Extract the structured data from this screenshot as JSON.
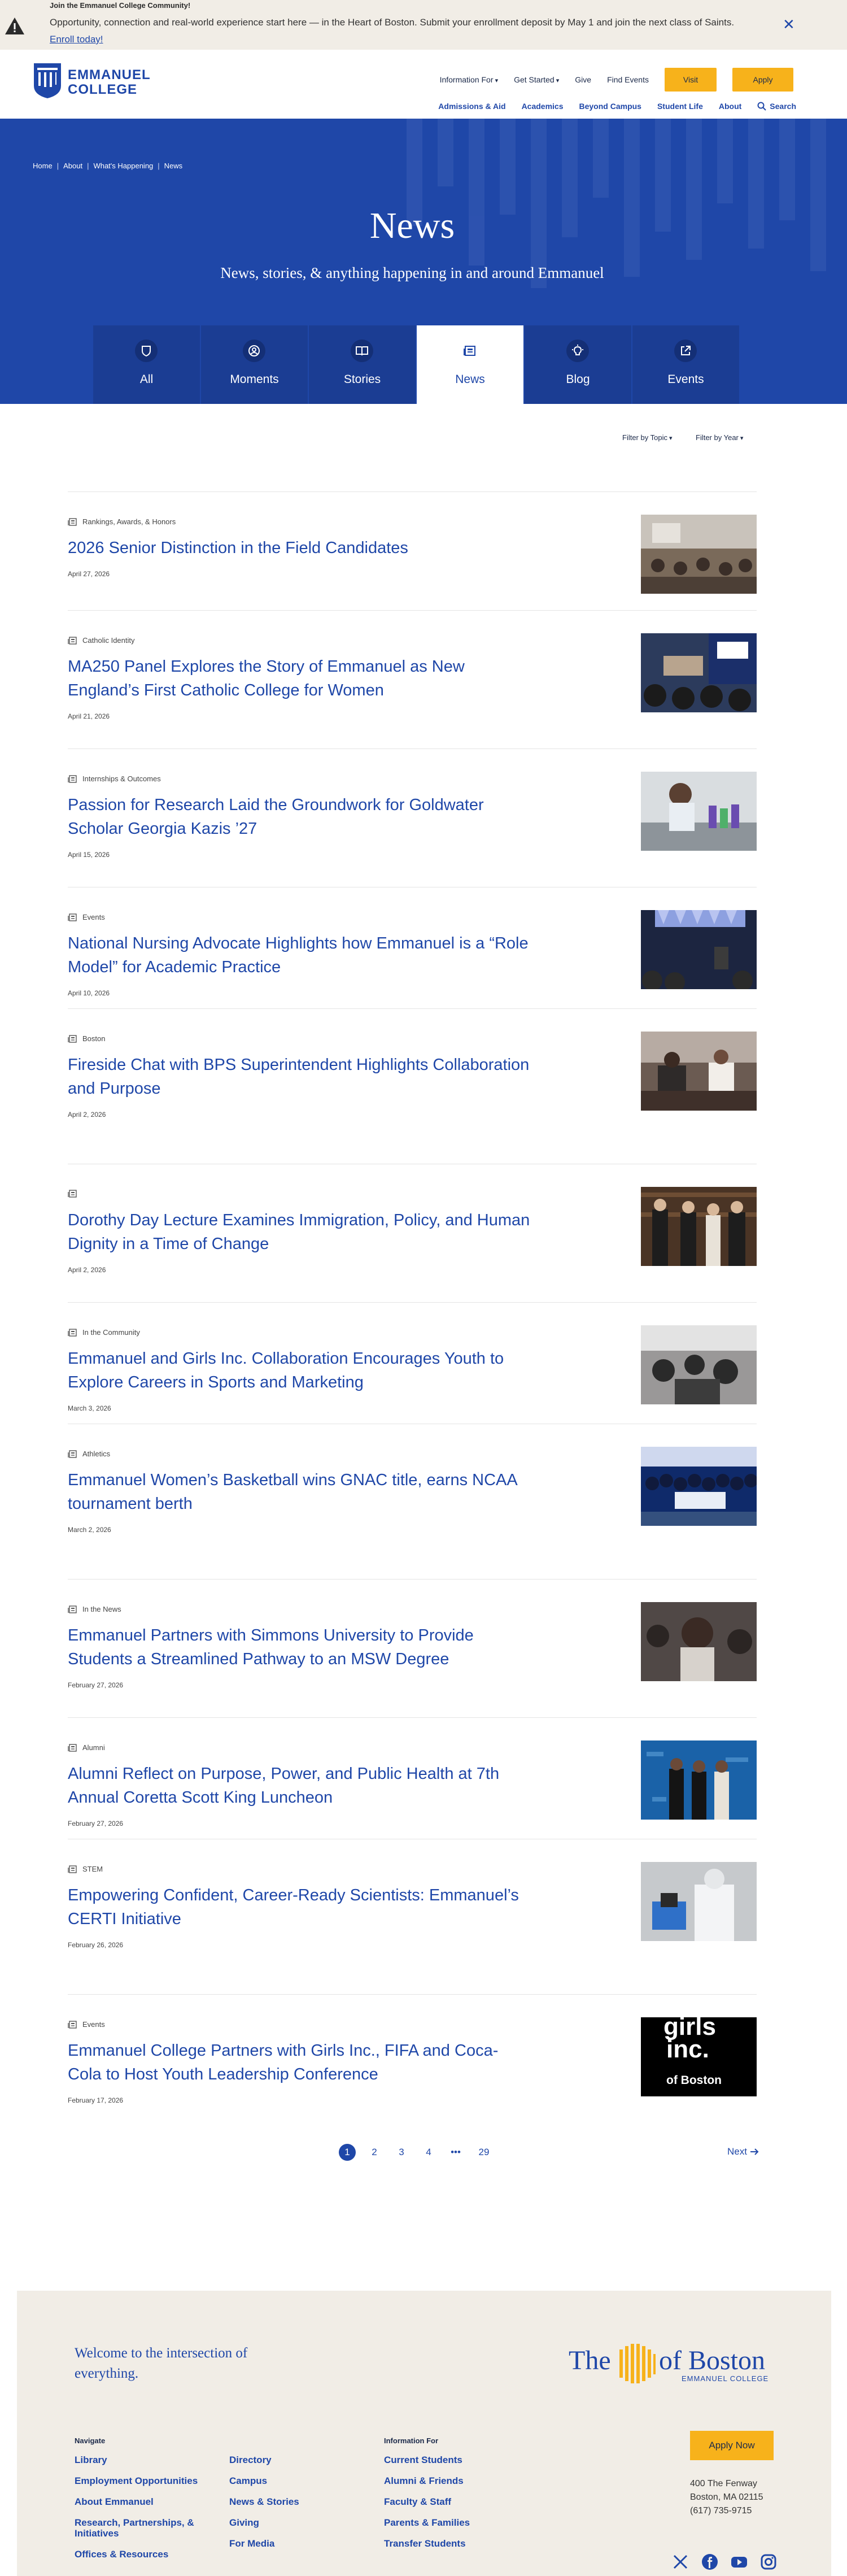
{
  "alert": {
    "title": "Join the Emmanuel College Community!",
    "message": "Opportunity, connection and real-world experience start here — in the Heart of Boston. Submit your enrollment deposit by May 1 and join the next class of Saints.",
    "link": "Enroll today!",
    "close_icon": "close-icon"
  },
  "header": {
    "logo_text_1": "EMMANUEL",
    "logo_text_2": "COLLEGE",
    "utility": [
      "Information For",
      "Get Started",
      "Give",
      "Find Events"
    ],
    "visit": "Visit",
    "apply": "Apply",
    "nav": [
      "Admissions & Aid",
      "Academics",
      "Beyond Campus",
      "Student Life",
      "About"
    ],
    "search": "Search"
  },
  "hero": {
    "breadcrumbs": [
      "Home",
      "About",
      "What's Happening",
      "News"
    ],
    "title": "News",
    "subtitle": "News, stories, & anything happening in and around Emmanuel",
    "tabs": [
      {
        "label": "All",
        "icon": "shield-icon"
      },
      {
        "label": "Moments",
        "icon": "person-icon"
      },
      {
        "label": "Stories",
        "icon": "book-icon"
      },
      {
        "label": "News",
        "icon": "newspaper-icon",
        "active": true
      },
      {
        "label": "Blog",
        "icon": "lightbulb-icon"
      },
      {
        "label": "Events",
        "icon": "external-link-icon"
      }
    ]
  },
  "filters": {
    "topic": "Filter by Topic",
    "year": "Filter by Year"
  },
  "news": [
    {
      "category": "Rankings, Awards, & Honors",
      "title": "2026 Senior Distinction in the Field Candidates",
      "date": "April 27, 2026",
      "lines": 1,
      "photo": "room"
    },
    {
      "category": "Catholic Identity",
      "title": "MA250 Panel Explores the Story of Emmanuel as New England’s First Catholic College for Women",
      "date": "April 21, 2026",
      "lines": 2,
      "photo": "panel"
    },
    {
      "category": "Internships & Outcomes",
      "title": "Passion for Research Laid the Groundwork for Goldwater Scholar Georgia Kazis ’27",
      "date": "April 15, 2026",
      "lines": 2,
      "photo": "lab"
    },
    {
      "category": "Events",
      "title": "National Nursing Advocate Highlights how Emmanuel is a “Role Model” for Academic Practice",
      "date": "April 10, 2026",
      "lines": 2,
      "photo": "lecture"
    },
    {
      "category": "Boston",
      "title": "Fireside Chat with BPS Superintendent Highlights Collaboration and Purpose",
      "date": "April 2, 2026",
      "lines": 2,
      "photo": "fireside"
    },
    {
      "category": "",
      "title": "Dorothy Day Lecture Examines Immigration, Policy, and Human Dignity in a Time of Change",
      "date": "April 2, 2026",
      "lines": 2,
      "photo": "library"
    },
    {
      "category": "In the Community",
      "title": "Emmanuel and Girls Inc. Collaboration Encourages Youth to Explore Careers in Sports and Marketing",
      "date": "March 3, 2026",
      "lines": 2,
      "photo": "girlsinc"
    },
    {
      "category": "Athletics",
      "title": "Emmanuel Women’s Basketball wins GNAC title, earns NCAA tournament berth",
      "date": "March 2, 2026",
      "lines": 2,
      "photo": "basketball"
    },
    {
      "category": "In the News",
      "title": "Emmanuel Partners with Simmons University to Provide Students a Streamlined Pathway to an MSW Degree",
      "date": "February 27, 2026",
      "lines": 2,
      "photo": "student"
    },
    {
      "category": "Alumni",
      "title": "Alumni Reflect on Purpose, Power, and Public Health at 7th Annual Coretta Scott King Luncheon",
      "date": "February 27, 2026",
      "lines": 2,
      "photo": "alumni"
    },
    {
      "category": "STEM",
      "title": "Empowering Confident, Career-Ready Scientists: Emmanuel’s CERTI Initiative",
      "date": "February 26, 2026",
      "lines": 2,
      "photo": "scientist"
    },
    {
      "category": "Events",
      "title": "Emmanuel College Partners with Girls Inc., FIFA and Coca-Cola to Host Youth Leadership Conference",
      "date": "February 17, 2026",
      "lines": 2,
      "photo": "girlsinc-logo",
      "photo_text_1": "girls",
      "photo_text_2": "inc.",
      "photo_text_3": "of Boston"
    }
  ],
  "pagination": {
    "pages": [
      "1",
      "2",
      "3",
      "4",
      "•••",
      "29"
    ],
    "current": "1",
    "next": "Next"
  },
  "footer": {
    "welcome": "Welcome to the intersection of everything.",
    "brand_the": "The",
    "brand_boston": "of Boston",
    "brand_college": "EMMANUEL COLLEGE",
    "navigate_heading": "Navigate",
    "navigate_col1": [
      "Library",
      "Employment Opportunities",
      "About Emmanuel",
      "Research, Partnerships, & Initiatives",
      "Offices & Resources"
    ],
    "navigate_col2": [
      "Directory",
      "Campus",
      "News & Stories",
      "Giving",
      "For Media"
    ],
    "info_heading": "Information For",
    "info_links": [
      "Current Students",
      "Alumni & Friends",
      "Faculty & Staff",
      "Parents & Families",
      "Transfer Students"
    ],
    "apply_now": "Apply Now",
    "address_1": "400 The Fenway",
    "address_2": "Boston, MA 02115",
    "phone": "(617) 735-9715",
    "social": [
      "x-icon",
      "facebook-icon",
      "youtube-icon",
      "instagram-icon"
    ],
    "brand_color": "#1f47a8",
    "accent_color": "#f7b21b"
  }
}
